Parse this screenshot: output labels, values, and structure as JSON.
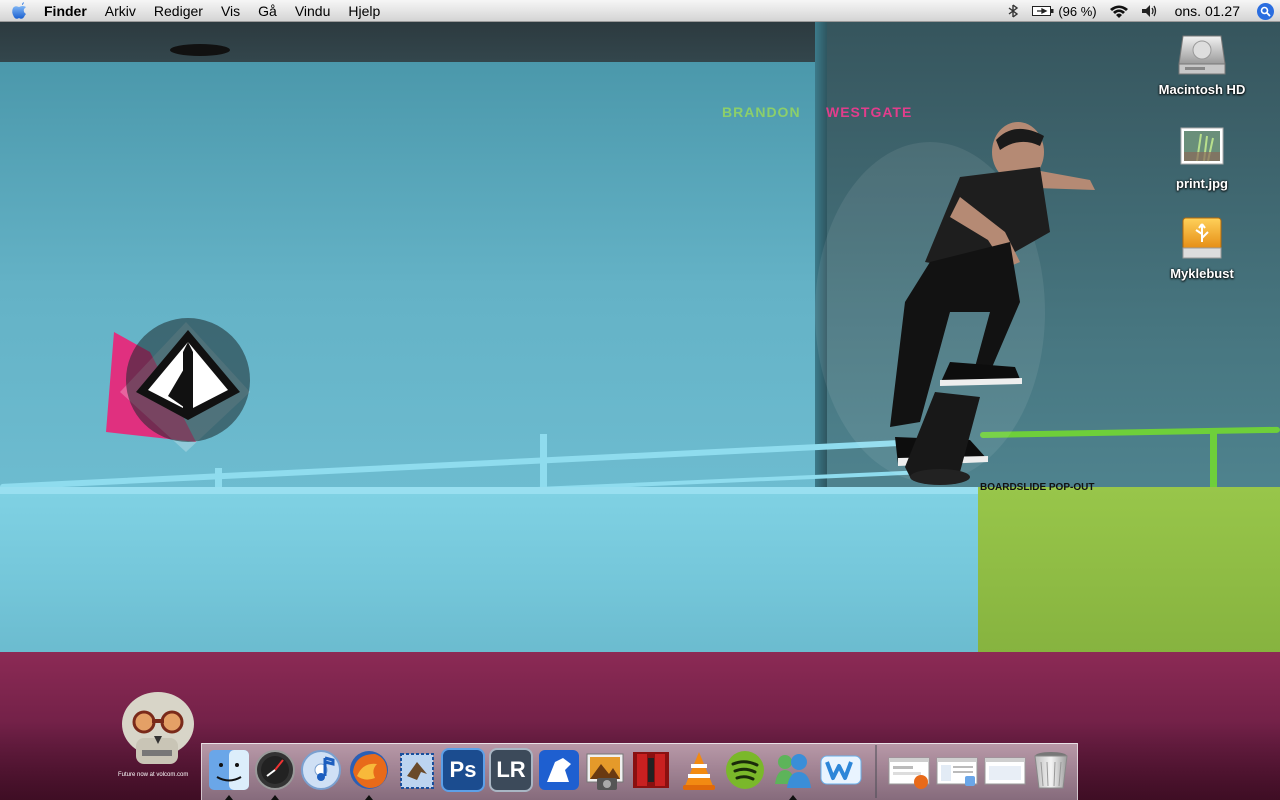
{
  "menubar": {
    "app_name": "Finder",
    "items": [
      "Arkiv",
      "Rediger",
      "Vis",
      "Gå",
      "Vindu",
      "Hjelp"
    ],
    "battery_percent": "(96 %)",
    "clock": "ons. 01.27",
    "icons": [
      "apple-icon",
      "bluetooth-icon",
      "battery-icon",
      "wifi-icon",
      "volume-icon",
      "spotlight-icon"
    ]
  },
  "desktop": {
    "icons": [
      {
        "label": "Macintosh HD",
        "icon": "hard-drive-icon"
      },
      {
        "label": "print.jpg",
        "icon": "image-file-icon"
      },
      {
        "label": "Myklebust",
        "icon": "usb-drive-icon"
      }
    ]
  },
  "wallpaper": {
    "name_first": "BRANDON",
    "name_last": "WESTGATE",
    "caption": "BOARDSLIDE POP-OUT",
    "skull_caption": "Future now at volcom.com",
    "colors": {
      "wall": "#64b2c6",
      "floor": "#8c2a55",
      "green": "#8cbf45",
      "pink": "#e23d8c"
    }
  },
  "dock": {
    "apps": [
      {
        "name": "Finder",
        "icon": "finder-icon",
        "running": true
      },
      {
        "name": "Dashboard",
        "icon": "dashboard-icon",
        "running": true
      },
      {
        "name": "iTunes",
        "icon": "itunes-icon",
        "running": false
      },
      {
        "name": "Firefox",
        "icon": "firefox-icon",
        "running": true
      },
      {
        "name": "Mail",
        "icon": "mail-icon",
        "running": false
      },
      {
        "name": "Photoshop",
        "icon": "photoshop-icon",
        "text": "Ps",
        "running": false
      },
      {
        "name": "Lightroom",
        "icon": "lightroom-icon",
        "text": "LR",
        "running": false
      },
      {
        "name": "Growl",
        "icon": "growl-icon",
        "running": false
      },
      {
        "name": "iPhoto",
        "icon": "iphoto-icon",
        "running": false
      },
      {
        "name": "Photo Booth",
        "icon": "photo-booth-icon",
        "running": false
      },
      {
        "name": "VLC",
        "icon": "vlc-icon",
        "running": false
      },
      {
        "name": "Spotify",
        "icon": "spotify-icon",
        "running": false
      },
      {
        "name": "Messenger",
        "icon": "messenger-icon",
        "running": true
      },
      {
        "name": "Writer",
        "icon": "writer-icon",
        "running": false
      }
    ],
    "stacks": [
      {
        "icon": "window-stack-firefox-icon"
      },
      {
        "icon": "window-stack-finder-icon"
      },
      {
        "icon": "window-stack-icon"
      },
      {
        "icon": "trash-icon"
      }
    ]
  }
}
